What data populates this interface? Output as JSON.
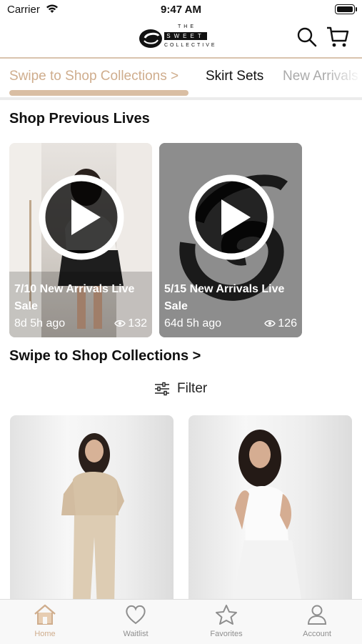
{
  "status": {
    "carrier": "Carrier",
    "time": "9:47 AM"
  },
  "header": {
    "logo": {
      "the": "THE",
      "sweet": "SWEET",
      "collective": "COLLECTIVE"
    }
  },
  "tabs": [
    {
      "label": "Swipe to Shop Collections >"
    },
    {
      "label": "Skirt Sets"
    },
    {
      "label": "New Arrivals"
    }
  ],
  "lives": {
    "title": "Shop Previous Lives",
    "cards": [
      {
        "title": "7/10 New Arrivals Live Sale",
        "ago": "8d 5h ago",
        "views": "132"
      },
      {
        "title": "5/15 New Arrivals Live Sale",
        "ago": "64d 5h ago",
        "views": "126"
      }
    ]
  },
  "collections": {
    "title": "Swipe to Shop Collections >",
    "filter_label": "Filter"
  },
  "tabbar": [
    {
      "label": "Home",
      "icon": "home-icon",
      "active": true
    },
    {
      "label": "Waitlist",
      "icon": "heart-icon"
    },
    {
      "label": "Favorites",
      "icon": "star-icon"
    },
    {
      "label": "Account",
      "icon": "person-icon"
    }
  ],
  "colors": {
    "accent": "#cfad8d",
    "underline": "#d9bea3"
  }
}
